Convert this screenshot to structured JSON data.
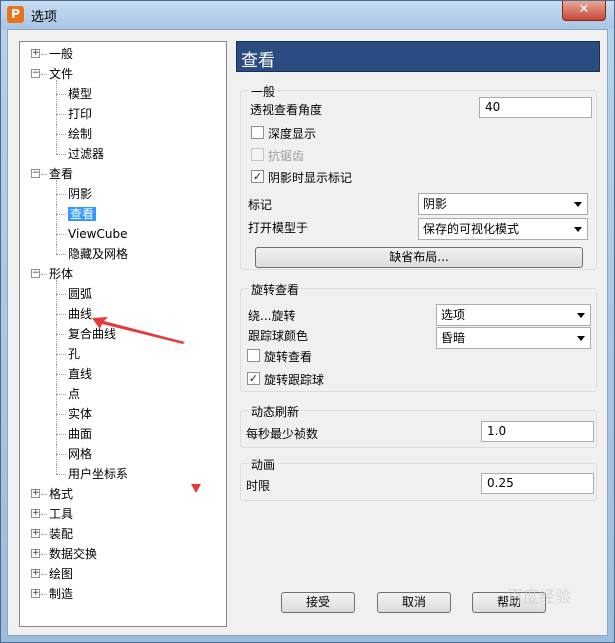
{
  "window": {
    "title": "选项",
    "app_icon_letter": "P",
    "close_glyph": "✕"
  },
  "tree": {
    "items": [
      {
        "label": "一般",
        "exp": "+"
      },
      {
        "label": "文件",
        "exp": "-"
      },
      {
        "label": "模型"
      },
      {
        "label": "打印"
      },
      {
        "label": "绘制"
      },
      {
        "label": "过滤器"
      },
      {
        "label": "查看",
        "exp": "-"
      },
      {
        "label": "阴影"
      },
      {
        "label": "查看",
        "selected": true
      },
      {
        "label": "ViewCube"
      },
      {
        "label": "隐藏及网格"
      },
      {
        "label": "形体",
        "exp": "-"
      },
      {
        "label": "圆弧"
      },
      {
        "label": "曲线"
      },
      {
        "label": "复合曲线"
      },
      {
        "label": "孔"
      },
      {
        "label": "直线"
      },
      {
        "label": "点"
      },
      {
        "label": "实体"
      },
      {
        "label": "曲面"
      },
      {
        "label": "网格"
      },
      {
        "label": "用户坐标系"
      },
      {
        "label": "格式",
        "exp": "+"
      },
      {
        "label": "工具",
        "exp": "+"
      },
      {
        "label": "装配",
        "exp": "+"
      },
      {
        "label": "数据交换",
        "exp": "+"
      },
      {
        "label": "绘图",
        "exp": "+"
      },
      {
        "label": "制造",
        "exp": "+"
      }
    ]
  },
  "panel": {
    "header": "查看",
    "general": {
      "title": "一般",
      "perspective_label": "透视查看角度",
      "perspective_value": "40",
      "depth_label": "深度显示",
      "depth_checked": false,
      "antialias_label": "抗锯齿",
      "antialias_checked": false,
      "shade_marker_label": "阴影时显示标记",
      "shade_marker_checked": true,
      "marker_label": "标记",
      "marker_value": "阴影",
      "open_model_label": "打开模型于",
      "open_model_value": "保存的可视化模式",
      "default_layout_button": "缺省布局..."
    },
    "rotate": {
      "title": "旋转查看",
      "around_label": "绕...旋转",
      "around_value": "选项",
      "ball_color_label": "跟踪球颜色",
      "ball_color_value": "昏暗",
      "rotate_view_label": "旋转查看",
      "rotate_view_checked": false,
      "rotate_ball_label": "旋转跟踪球",
      "rotate_ball_checked": true
    },
    "refresh": {
      "title": "动态刷新",
      "fps_label": "每秒最少祯数",
      "fps_value": "1.0"
    },
    "animation": {
      "title": "动画",
      "duration_label": "时限",
      "duration_value": "0.25"
    }
  },
  "buttons": {
    "ok": "接受",
    "cancel": "取消",
    "help": "帮助"
  },
  "colors": {
    "header_bg": "#2b4c80",
    "selection": "#3399ff",
    "annotation": "#e63b3b"
  },
  "watermark": "百度经验"
}
